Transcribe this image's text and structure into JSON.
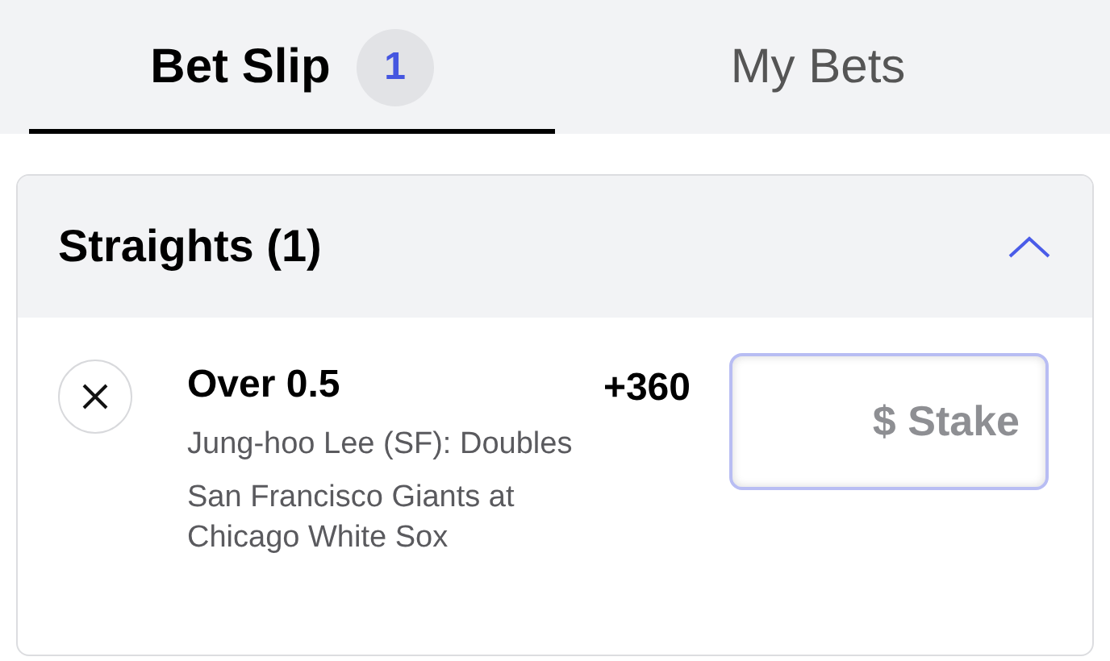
{
  "tabs": [
    {
      "label": "Bet Slip",
      "badge": "1",
      "selected": true
    },
    {
      "label": "My Bets",
      "selected": false
    }
  ],
  "section": {
    "title": "Straights (1)",
    "expanded": true,
    "bets": [
      {
        "selection": "Over 0.5",
        "market": "Jung-hoo Lee (SF): Doubles",
        "event": "San Francisco Giants at Chicago White Sox",
        "odds": "+360",
        "stake": {
          "placeholder": "$ Stake"
        }
      }
    ]
  }
}
